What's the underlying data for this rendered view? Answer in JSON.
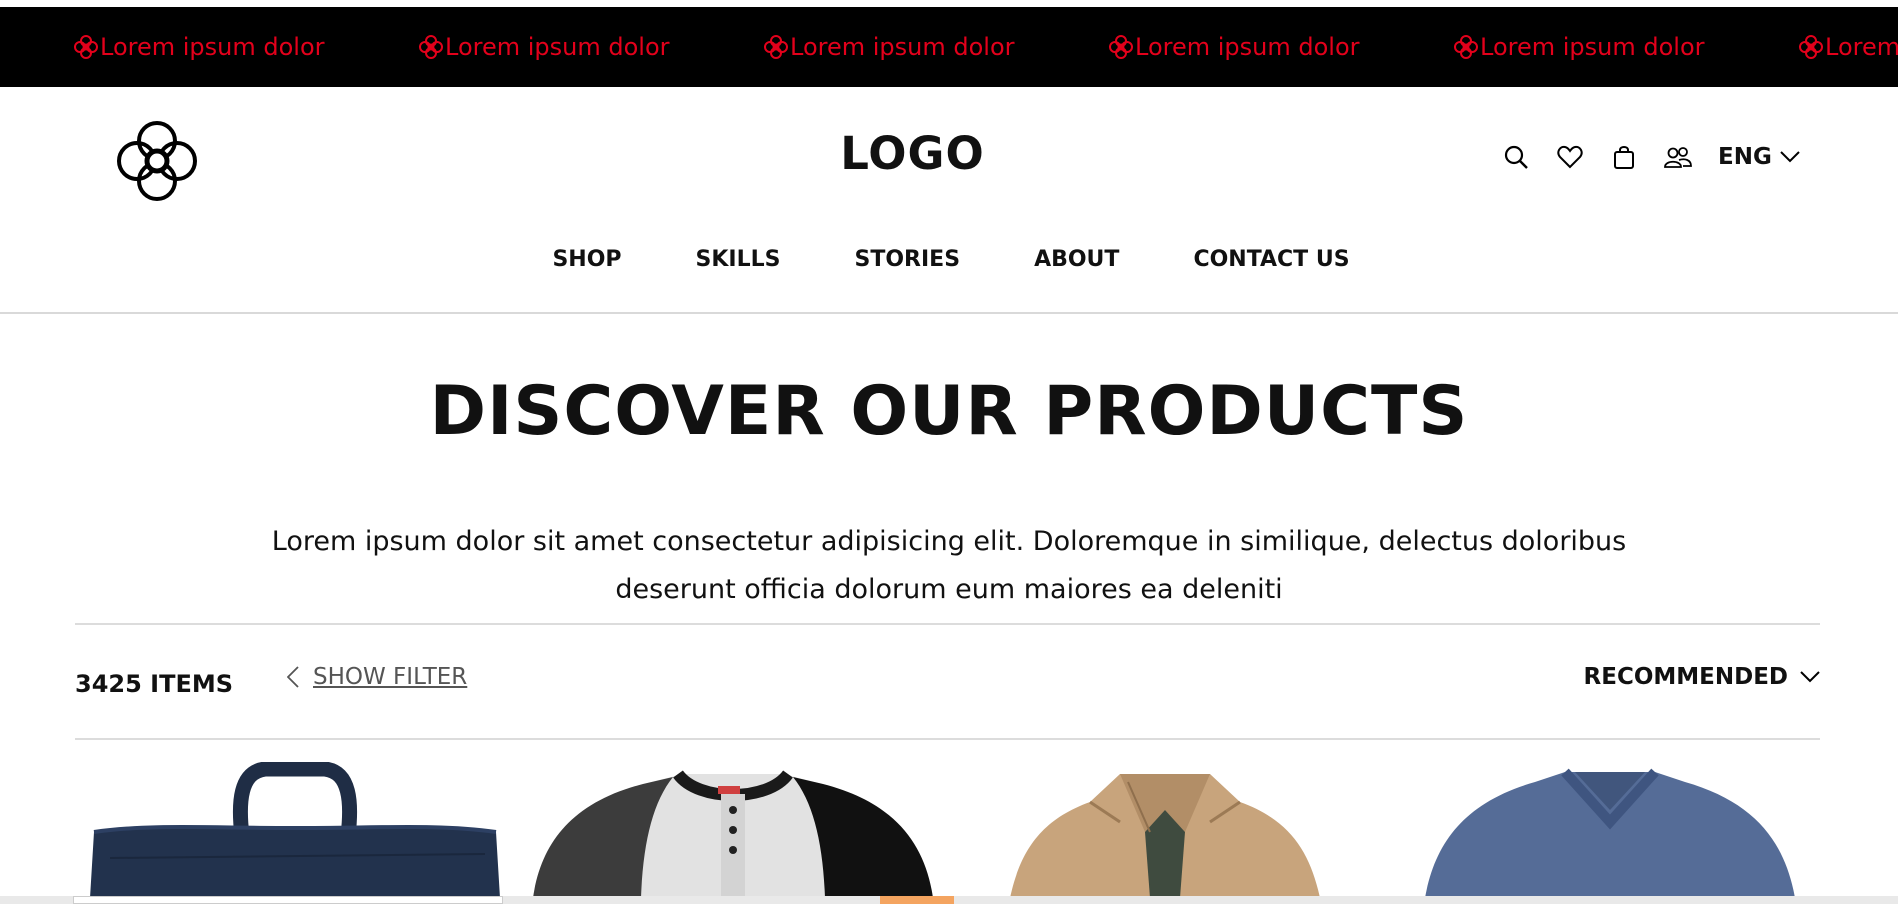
{
  "announcement": {
    "items": [
      "Lorem ipsum dolor",
      "Lorem ipsum dolor",
      "Lorem ipsum dolor",
      "Lorem ipsum dolor",
      "Lorem ipsum dolor",
      "Lorem"
    ],
    "icon": "flower-icon",
    "text_color": "#e3001b",
    "background": "#000000"
  },
  "header": {
    "brand_icon": "flower-icon",
    "logo": "LOGO",
    "icons": [
      "search-icon",
      "heart-icon",
      "bag-icon",
      "users-icon"
    ],
    "language": "ENG"
  },
  "nav": {
    "items": [
      "SHOP",
      "SKILLS",
      "STORIES",
      "ABOUT",
      "CONTACT US"
    ]
  },
  "hero": {
    "title": "DISCOVER OUR PRODUCTS",
    "line1": "Lorem ipsum dolor sit amet consectetur adipisicing elit. Doloremque in similique, delectus doloribus",
    "line2": "deserunt officia dolorum eum maiores ea deleniti"
  },
  "toolbar": {
    "count": "3425 ITEMS",
    "filter_label": "SHOW FILTER",
    "sort_label": "RECOMMENDED"
  },
  "products": [
    {
      "name": "navy-bag"
    },
    {
      "name": "raglan-henley-shirt"
    },
    {
      "name": "khaki-jacket"
    },
    {
      "name": "blue-v-neck-tee"
    }
  ]
}
